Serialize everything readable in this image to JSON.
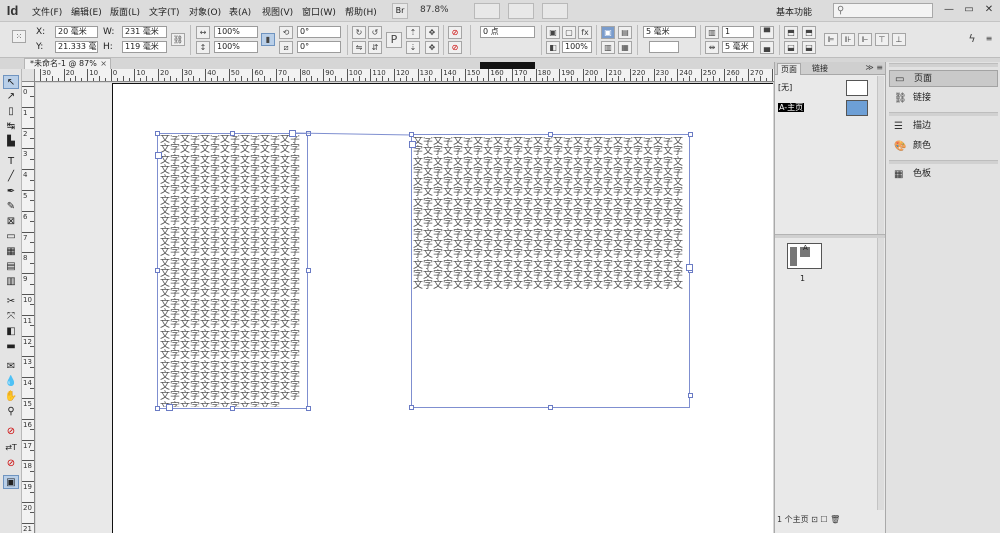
{
  "app": {
    "logo": "Id"
  },
  "menu": {
    "items": [
      "文件(F)",
      "编辑(E)",
      "版面(L)",
      "文字(T)",
      "对象(O)",
      "表(A)",
      "视图(V)",
      "窗口(W)",
      "帮助(H)"
    ],
    "zoom": "87.8%",
    "bridge_label": "Br",
    "workspace": "基本功能",
    "window_controls": [
      "—",
      "▭",
      "✕"
    ]
  },
  "control": {
    "x_label": "X:",
    "x_value": "20 毫米",
    "y_label": "Y:",
    "y_value": "21.333 毫米",
    "w_label": "W:",
    "w_value": "231 毫米",
    "h_label": "H:",
    "h_value": "119 毫米",
    "scale_x": "100%",
    "scale_y": "100%",
    "angle": "0°",
    "shear": "0°",
    "stroke_weight": "0 点",
    "stroke_type": "",
    "opacity": "100%",
    "columns": "1",
    "column_gutter": "5 毫米",
    "spacing": "5 毫米",
    "para_p": "P"
  },
  "document": {
    "tab_title": "*未命名-1 @ 87%",
    "close": "×"
  },
  "ruler": {
    "h_labels": [
      "30",
      "20",
      "10",
      "0",
      "10",
      "20",
      "30",
      "40",
      "50",
      "60",
      "70",
      "80",
      "90",
      "100",
      "110",
      "120",
      "130",
      "140",
      "150",
      "160",
      "170",
      "180",
      "190",
      "200",
      "210",
      "220",
      "230",
      "240",
      "250",
      "260",
      "270",
      "280"
    ],
    "v_labels": [
      "0",
      "1",
      "2",
      "3",
      "4",
      "5",
      "6",
      "7",
      "8",
      "9",
      "10",
      "11",
      "12",
      "13",
      "14",
      "15",
      "16",
      "17",
      "18",
      "19",
      "20",
      "21"
    ]
  },
  "frames": {
    "left_text": "文字文字文字文字文字文字文字文字文字文字文字文字文字文字文字文字文字文字文字文字文字文字文字文字文字文字文字文字文字文字文字文字文字文字文字文字文字文字文字文字文字文字文字文字文字文字文字文字文字文字文字文字文字文字文字文字文字文字文字文字文字文字文字文字文字文字文字文字文字文字文字文字文字文字文字文字文字文字文字文字文字文字文字文字文字文字文字文字文字文字文字文字文字文字文字文字文字文字文字文字文字文字文字文字文字文字文字文字文字文字文字文字文字文字文字文字文字文字文字文字文字文字文字文字文字文字文字文字文字文字文字文字文字文字文字文字文字文字文字文字文字文字文字文字文字文字文字文字文字文字文字文字文字文字文字文字文字文字文字文字文字文字文字文字文字文字文字文字文字文字文字文字文字文字文字文字文字文字文字文字文字文字文字文字文字文字文字文字",
    "right_text": "文字文字文字文字文字文字文字文字文字文字文字文字文字文字文字文字文字文字文字文字文字文字文字文字文字文字文字文字文字文字文字文字文字文字文字文字文字文字文字文字文字文字文字文字文字文字文字文字文字文字文字文字文字文字文字文字文字文字文字文字文字文字文字文字文字文字文字文字文字文字文字文字文字文字文字文字文字文字文字文字文字文字文字文字文字文字文字文字文字文字文字文字文字文字文字文字文字文字文字文字文字文字文字文字文字文字文字文字文字文字文字文字文字文字文字文字文字文字文字文字文字文字文字文字文字文字文字文字文字文字文字文字文字文字文字文字文字文字文字文字文字文字文字文字文字文字文字文字文字文字文字文字文字文字文字文字文字文字文字文字文字文字文字文字文字文字文字文字文字文字文字文字文字文字文字文字文字文字文字文字文字文字文字文字文字文字文字文字文字文字文字文字文字文字文字文字文字文字文字文字文字文字文字文字文字文字文字文字文字文字文字"
  },
  "pages_panel": {
    "tabs": [
      "页面",
      "链接"
    ],
    "menu": "≫ ≡",
    "masters": [
      "[无]",
      "A-主页"
    ],
    "page_thumb_label": "A",
    "page_number": "1",
    "status": "1 个主页 ⊡ ☐ 🗑"
  },
  "dock": {
    "items": [
      {
        "icon": "pages-icon",
        "label": "页面"
      },
      {
        "icon": "links-icon",
        "label": "链接"
      },
      {
        "icon": "stroke-icon",
        "label": "描边"
      },
      {
        "icon": "color-icon",
        "label": "颜色"
      },
      {
        "icon": "swatches-icon",
        "label": "色板"
      }
    ]
  }
}
